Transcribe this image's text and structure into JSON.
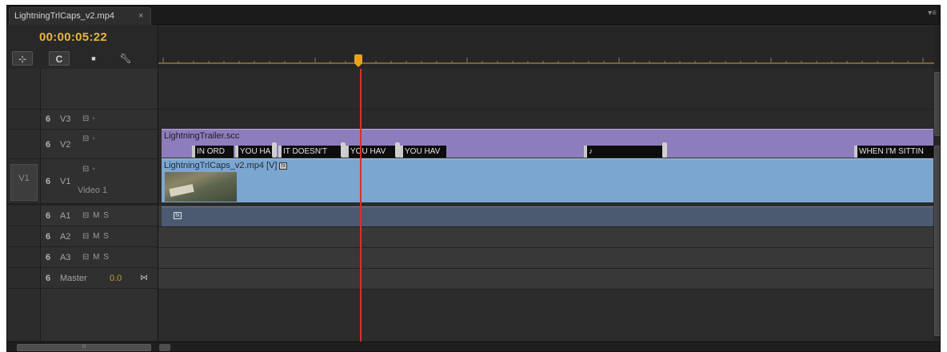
{
  "tab": {
    "title": "LightningTrlCaps_v2.mp4",
    "close": "×",
    "menu_icon": "hamburger-menu-icon"
  },
  "timecode": "00:00:05:22",
  "toolbar": {
    "snap": "snap-icon",
    "linked": "C",
    "marker": "marker-icon",
    "settings": "wrench-icon"
  },
  "tracks": {
    "v3": {
      "lock": "6",
      "label": "V3",
      "icons": "⊟◦"
    },
    "v2": {
      "lock": "6",
      "label": "V2",
      "icons": "⊟◦"
    },
    "v1": {
      "source": "V1",
      "lock": "6",
      "label": "V1",
      "icons": "⊟◦",
      "name": "Video 1"
    },
    "a1": {
      "lock": "6",
      "label": "A1",
      "icons": "⊟ M S"
    },
    "a2": {
      "lock": "6",
      "label": "A2",
      "icons": "⊟ M S"
    },
    "a3": {
      "lock": "6",
      "label": "A3",
      "icons": "⊟ M S"
    },
    "master": {
      "lock": "6",
      "label": "Master",
      "value": "0.0",
      "icon": "⋈"
    }
  },
  "clips": {
    "captions": {
      "name": "LightningTrailer.scc",
      "blocks": [
        "IN ORD",
        "YOU HA",
        "IT DOESN'T",
        "YOU HAV",
        "YOU HAV",
        "♪",
        "WHEN I'M SITTIN"
      ]
    },
    "video": {
      "name": "LightningTrlCaps_v2.mp4 [V]",
      "fx": "fx"
    },
    "audio": {
      "fx": "fx"
    }
  },
  "colors": {
    "timecode": "#e8b53b",
    "caption_clip": "#8e7dbc",
    "video_clip": "#7ba6d0",
    "audio_clip": "#4b5a71",
    "playhead": "#d5332b"
  }
}
